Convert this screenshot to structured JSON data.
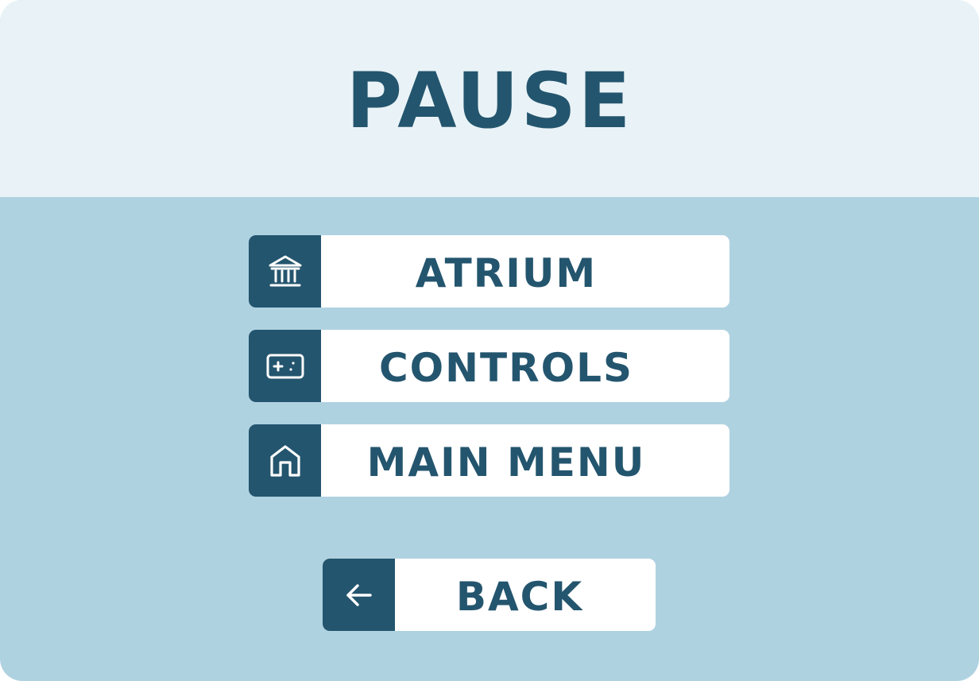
{
  "title": "PAUSE",
  "colors": {
    "primary": "#24556e",
    "header_bg": "#e9f3f7",
    "body_bg": "#afd2e1",
    "button_bg": "#ffffff"
  },
  "menu": {
    "items": [
      {
        "label": "ATRIUM",
        "icon": "museum-icon"
      },
      {
        "label": "CONTROLS",
        "icon": "gamepad-icon"
      },
      {
        "label": "MAIN MENU",
        "icon": "home-icon"
      }
    ]
  },
  "back": {
    "label": "BACK",
    "icon": "arrow-left-icon"
  }
}
